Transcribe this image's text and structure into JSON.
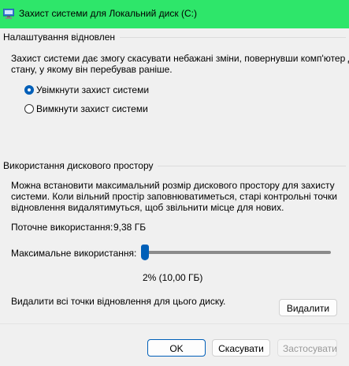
{
  "window": {
    "title": "Захист системи для Локальний диск (C:)",
    "accent_color": "#2ee66a",
    "icon": "system-protection-icon"
  },
  "restore_settings": {
    "group_title": "Налаштування відновлен",
    "description_line1": "Захист системи дає змогу скасувати небажані зміни, повернувши комп'ютер до",
    "description_line2": "стану, у якому він перебував раніше.",
    "options": [
      {
        "label": "Увімкнути захист системи",
        "selected": true
      },
      {
        "label": "Вимкнути захист системи",
        "selected": false
      }
    ]
  },
  "disk_usage": {
    "group_title": "Використання дискового простору",
    "description_line1": "Можна встановити максимальний розмір дискового простору для захисту",
    "description_line2": "системи. Коли вільний простір заповнюватиметься, старі контрольні точки",
    "description_line3": "відновлення видалятимуться, щоб звільнити місце для нових.",
    "current_label": "Поточне використання:",
    "current_value": "9,38 ГБ",
    "max_label": "Максимальне використання:",
    "slider_percent": 2,
    "max_value_text": "2% (10,00 ГБ)",
    "delete_text": "Видалити всі точки відновлення для цього диску.",
    "delete_button": "Видалити"
  },
  "buttons": {
    "ok": "OK",
    "cancel": "Скасувати",
    "apply": "Застосувати"
  }
}
